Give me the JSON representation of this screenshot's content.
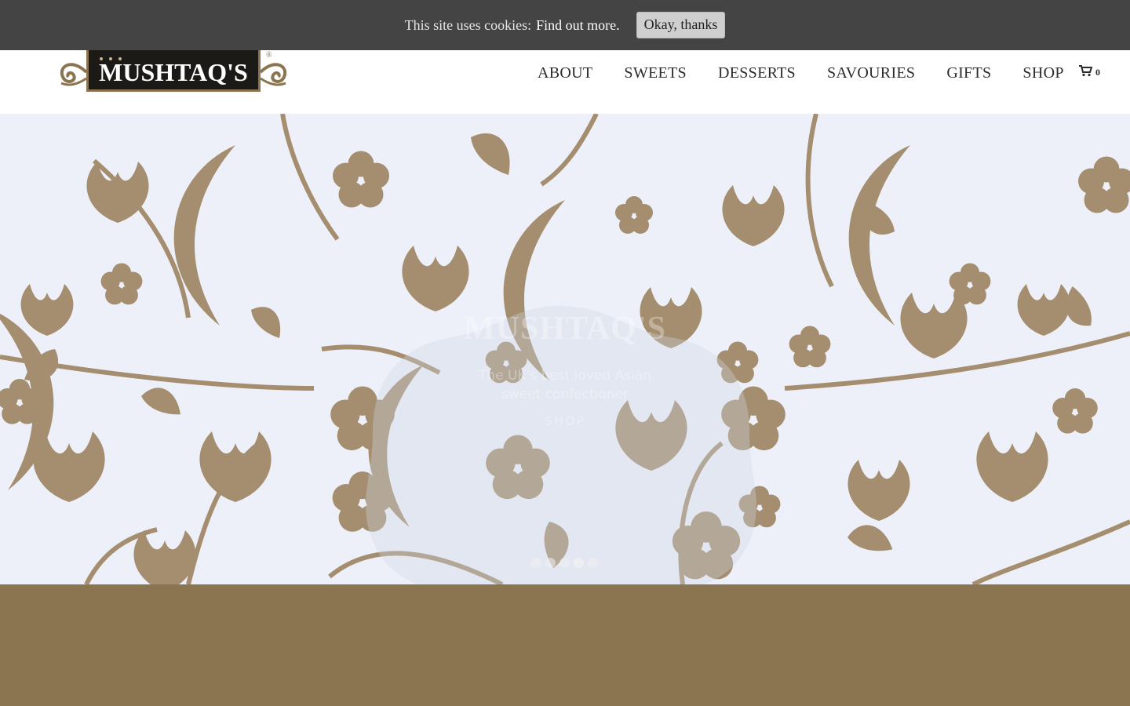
{
  "cookie_bar": {
    "message": "This site uses cookies:",
    "link_label": "Find out more.",
    "button_label": "Okay, thanks",
    "background": "#444444"
  },
  "header": {
    "logo_text": "MUSHTAQ'S",
    "logo_mark": "®",
    "nav": [
      {
        "label": "ABOUT"
      },
      {
        "label": "SWEETS"
      },
      {
        "label": "DESSERTS"
      },
      {
        "label": "SAVOURIES"
      },
      {
        "label": "GIFTS"
      },
      {
        "label": "SHOP"
      }
    ],
    "cart_icon": "shopping-cart-icon",
    "cart_count": "0"
  },
  "hero": {
    "pattern_color": "#a48e6f",
    "background": "#edf0f8",
    "brand": "MUSHTAQ'S",
    "tagline": "The UK's best loved Asian sweet confectioner",
    "cta": "SHOP",
    "slides_total": 5,
    "active_slide": 4
  },
  "colors": {
    "gold": "#8b7550",
    "logo_dark": "#1c1a17"
  }
}
